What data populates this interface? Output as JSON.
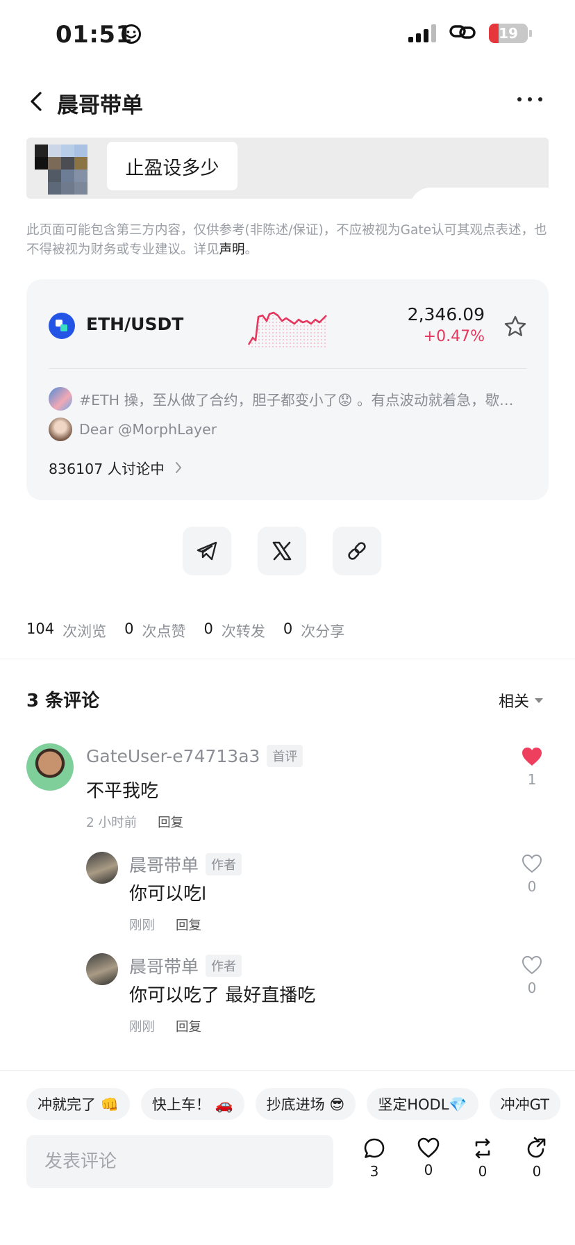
{
  "status_bar": {
    "time": "01:51",
    "battery": "19"
  },
  "header": {
    "title": "晨哥带单"
  },
  "post": {
    "image_bubble_text": "止盈设多少",
    "disclaimer_text": "此页面可能包含第三方内容，仅供参考(非陈述/保证)，不应被视为Gate认可其观点表述，也不得被视为财务或专业建议。详见",
    "disclaimer_link": "声明",
    "disclaimer_end": "。"
  },
  "market": {
    "pair": "ETH/USDT",
    "price": "2,346.09",
    "change": "+0.47%",
    "post_line_1": "#ETH 操，至从做了合约，胆子都变小了😟 。有点波动就着急，歇…",
    "post_line_2": "Dear @MorphLayer",
    "discussion": "836107 人讨论中",
    "colors": {
      "up": "#e5375e",
      "icon": "#2354e6"
    }
  },
  "stats": [
    {
      "num": "104",
      "label": "次浏览"
    },
    {
      "num": "0",
      "label": "次点赞"
    },
    {
      "num": "0",
      "label": "次转发"
    },
    {
      "num": "0",
      "label": "次分享"
    }
  ],
  "comments_section": {
    "title": "3 条评论",
    "sort_label": "相关"
  },
  "comments": [
    {
      "name": "GateUser-e74713a3",
      "tag": "首评",
      "text": "不平我吃",
      "time": "2 小时前",
      "reply": "回复",
      "likes": "1",
      "liked": true
    },
    {
      "name": "晨哥带单",
      "tag": "作者",
      "text": "你可以吃l",
      "time": "刚刚",
      "reply": "回复",
      "likes": "0",
      "liked": false
    },
    {
      "name": "晨哥带单",
      "tag": "作者",
      "text": "你可以吃了 最好直播吃",
      "time": "刚刚",
      "reply": "回复",
      "likes": "0",
      "liked": false
    }
  ],
  "quick_replies": [
    "冲就完了 👊",
    "快上车！ 🚗",
    "抄底进场 😎",
    "坚定HODL💎",
    "冲冲GT"
  ],
  "bottom_bar": {
    "input_placeholder": "发表评论",
    "comment_count": "3",
    "like_count": "0",
    "repost_count": "0",
    "share_count": "0"
  }
}
